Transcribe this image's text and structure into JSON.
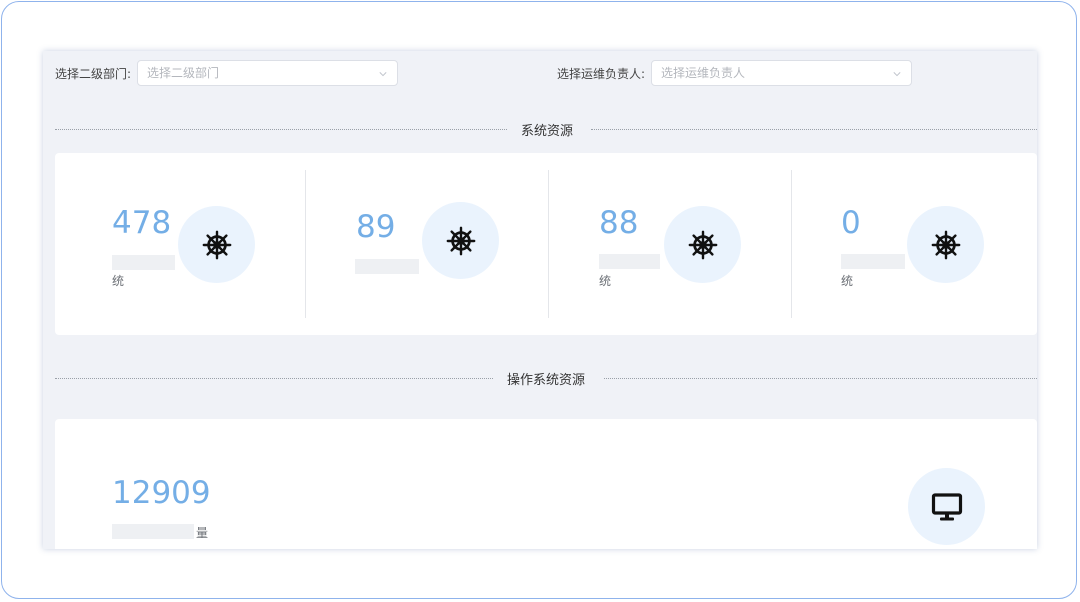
{
  "filters": {
    "department": {
      "label": "选择二级部门:",
      "placeholder": "选择二级部门"
    },
    "owner": {
      "label": "选择运维负责人:",
      "placeholder": "选择运维负责人"
    }
  },
  "sections": {
    "system": {
      "title": "系统资源"
    },
    "os": {
      "title": "操作系统资源"
    }
  },
  "system_stats": [
    {
      "value": "478",
      "unit": "统",
      "icon": "dharma-wheel-icon"
    },
    {
      "value": "89",
      "unit": "",
      "icon": "dharma-wheel-icon"
    },
    {
      "value": "88",
      "unit": "统",
      "icon": "dharma-wheel-icon"
    },
    {
      "value": "0",
      "unit": "统",
      "icon": "dharma-wheel-icon"
    }
  ],
  "os_stat": {
    "value": "12909",
    "unit": "量",
    "icon": "monitor-icon"
  },
  "colors": {
    "accent": "#74aee6",
    "icon_bg": "#eaf3fd",
    "panel_bg": "#f0f2f7",
    "border": "#8fb3ec"
  }
}
